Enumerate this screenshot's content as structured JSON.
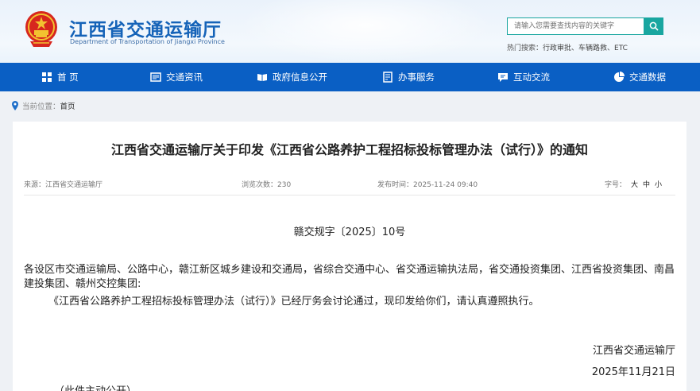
{
  "header": {
    "title": "江西省交通运输厅",
    "subtitle": "Department of Transportation of Jiangxi Province",
    "search_placeholder": "请输入您需要查找内容的关键字",
    "hot_label": "热门搜索：",
    "hot_terms": "行政审批、车辆路救、ETC"
  },
  "nav": {
    "items": [
      {
        "label": "首 页",
        "icon": "home-icon"
      },
      {
        "label": "交通资讯",
        "icon": "news-icon"
      },
      {
        "label": "政府信息公开",
        "icon": "book-icon"
      },
      {
        "label": "办事服务",
        "icon": "service-icon"
      },
      {
        "label": "互动交流",
        "icon": "chat-icon"
      },
      {
        "label": "交通数据",
        "icon": "pie-chart-icon"
      }
    ]
  },
  "breadcrumb": {
    "label": "当前位置：",
    "current": "首页"
  },
  "article": {
    "title": "江西省交通运输厅关于印发《江西省公路养护工程招标投标管理办法（试行）》的通知",
    "source": "来源：江西省交通运输厅",
    "views": "浏览次数：230",
    "published": "发布时间：2025-11-24 09:40",
    "font_size_label": "字号：",
    "font_large": "大",
    "font_medium": "中",
    "font_small": "小",
    "doc_number": "赣交规字〔2025〕10号",
    "recipients": "各设区市交通运输局、公路中心，赣江新区城乡建设和交通局，省综合交通中心、省交通运输执法局，省交通投资集团、江西省投资集团、南昌建投集团、赣州交控集团:",
    "body": "《江西省公路养护工程招标投标管理办法（试行）》已经厅务会讨论通过，现印发给你们，请认真遵照执行。",
    "signature": "江西省交通运输厅",
    "date": "2025年11月21日",
    "note": "（此件主动公开）"
  },
  "colors": {
    "nav_bg": "#0a5fc4",
    "title_blue": "#1563b8",
    "search_accent": "#19a6a0"
  }
}
